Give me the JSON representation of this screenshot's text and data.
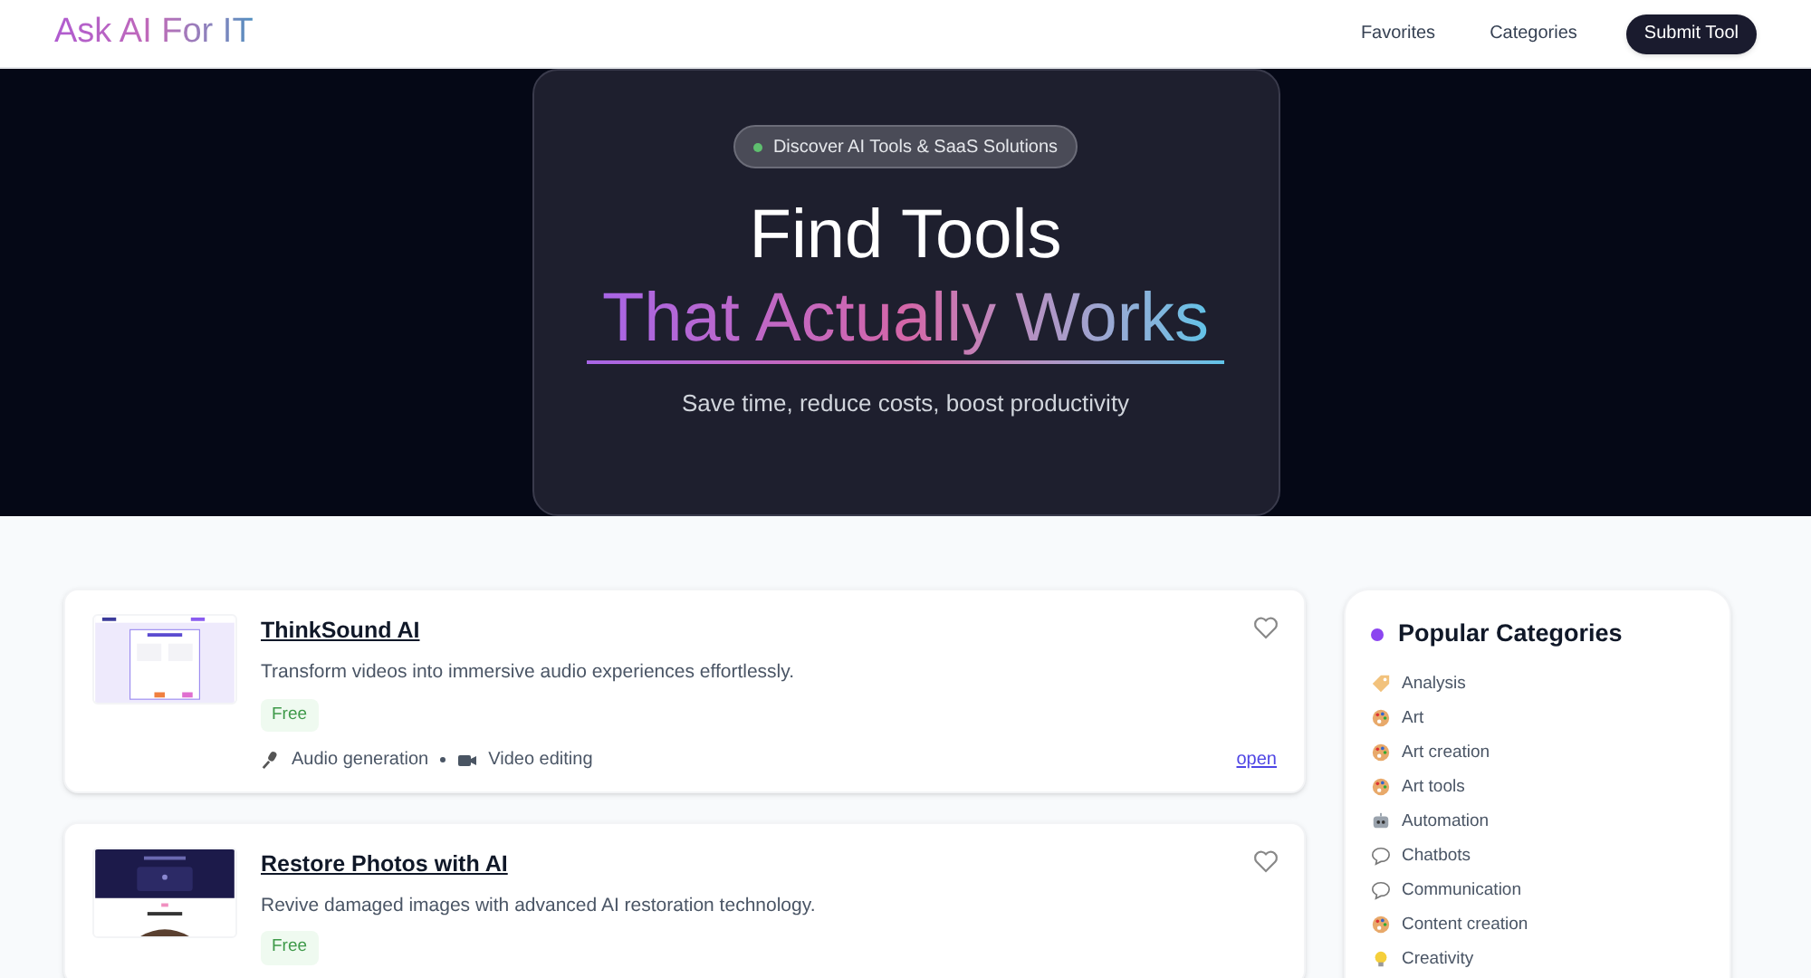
{
  "header": {
    "logo": "Ask AI For IT",
    "nav": [
      "Favorites",
      "Categories"
    ],
    "cta": "Submit Tool"
  },
  "hero": {
    "badge": "Discover AI Tools & SaaS Solutions",
    "title": "Find Tools",
    "highlight": "That Actually Works",
    "subtitle": "Save time, reduce costs, boost productivity"
  },
  "tools": [
    {
      "name": "ThinkSound AI",
      "description": "Transform videos into immersive audio experiences effortlessly.",
      "pricing": "Free",
      "thumbnail": {
        "kind": "light"
      },
      "favorite": false,
      "tags": [
        {
          "kind": "mic",
          "label": "Audio generation"
        },
        {
          "kind": "camera",
          "label": "Video editing"
        }
      ],
      "link": "open"
    },
    {
      "name": "Restore Photos with AI",
      "description": "Revive damaged images with advanced AI restoration technology.",
      "pricing": "Free",
      "thumbnail": {
        "kind": "dark"
      },
      "favorite": false
    }
  ],
  "sidebar": {
    "title": "Popular Categories",
    "items": [
      {
        "kind": "tag",
        "label": "Analysis"
      },
      {
        "kind": "palette",
        "label": "Art"
      },
      {
        "kind": "palette",
        "label": "Art creation"
      },
      {
        "kind": "palette",
        "label": "Art tools"
      },
      {
        "kind": "robot",
        "label": "Automation"
      },
      {
        "kind": "chat",
        "label": "Chatbots"
      },
      {
        "kind": "chat",
        "label": "Communication"
      },
      {
        "kind": "palette",
        "label": "Content creation"
      },
      {
        "kind": "bulb",
        "label": "Creativity"
      }
    ]
  }
}
